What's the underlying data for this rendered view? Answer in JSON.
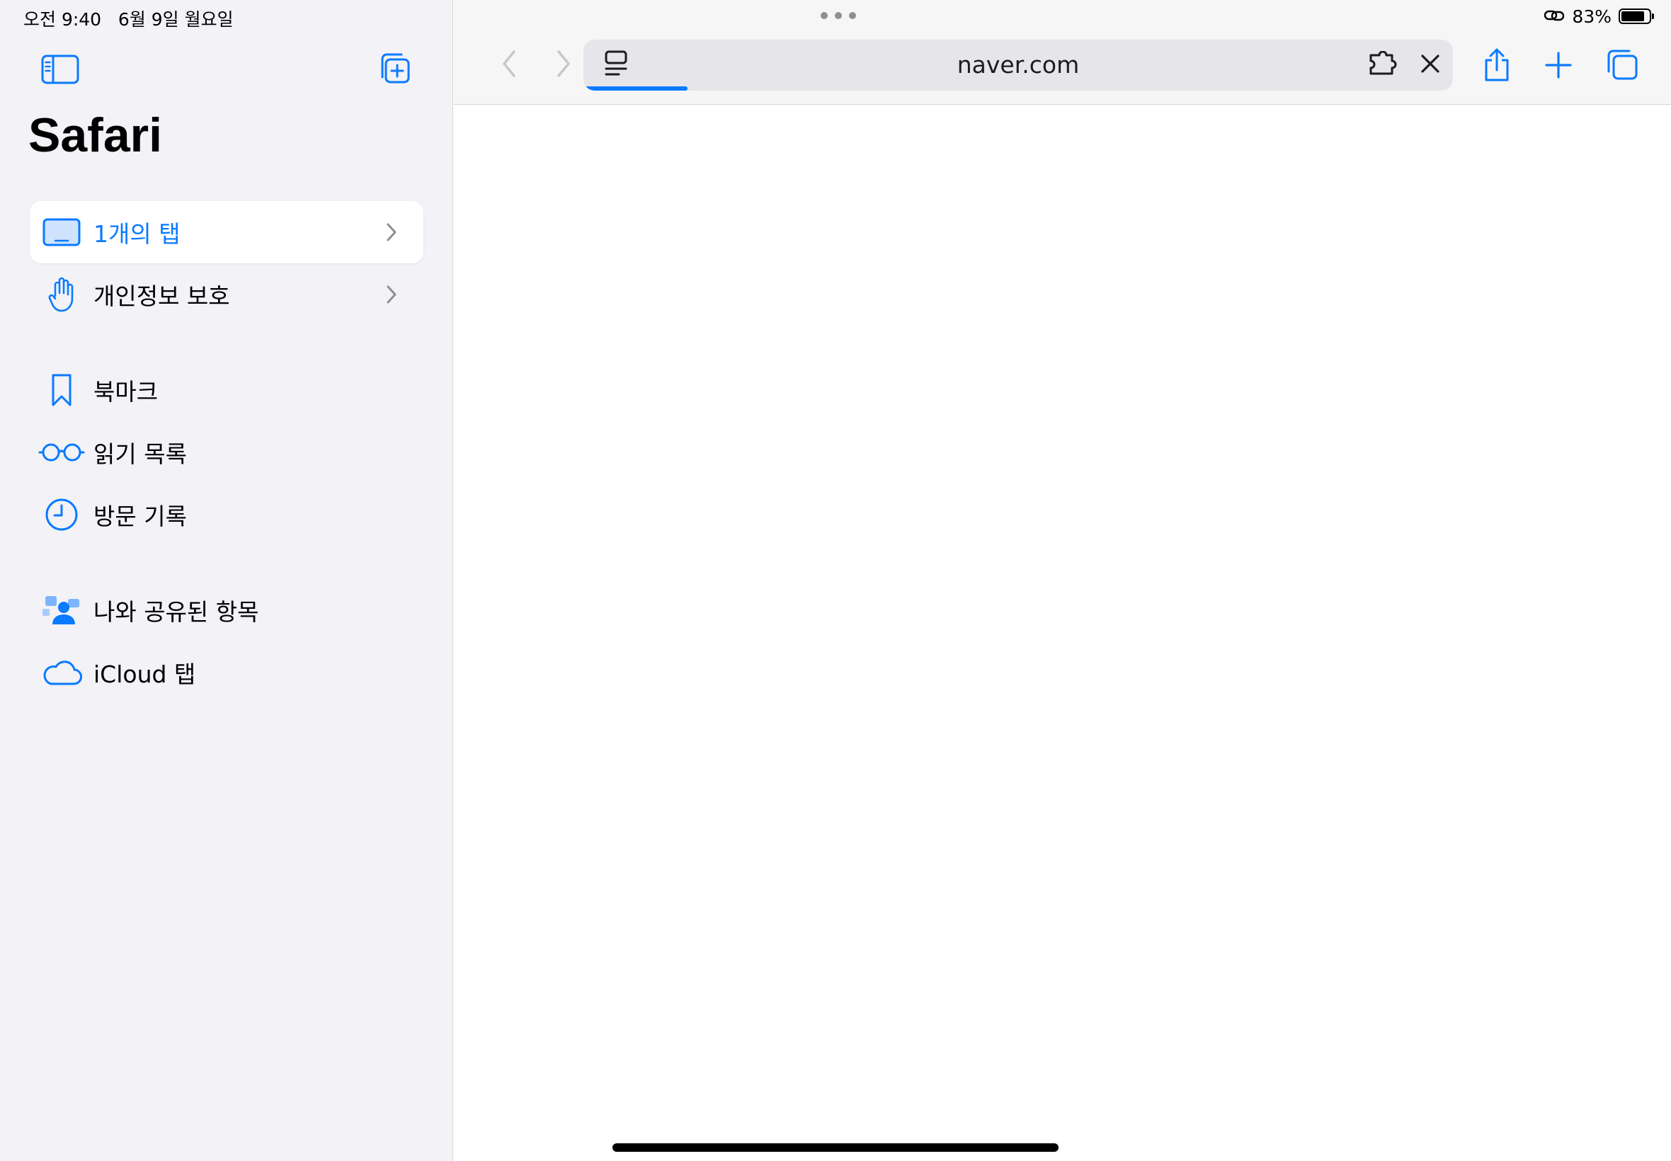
{
  "status_bar": {
    "time_date": "오전 9:40   6월 9일 월요일",
    "battery_percent": "83%",
    "battery_level": 0.83
  },
  "sidebar": {
    "title": "Safari",
    "groups": [
      {
        "items": [
          {
            "label": "1개의 탭",
            "icon": "tab-group-icon",
            "selected": true,
            "chevron": true
          },
          {
            "label": "개인정보 보호",
            "icon": "hand-raised-icon",
            "selected": false,
            "chevron": true
          }
        ]
      },
      {
        "items": [
          {
            "label": "북마크",
            "icon": "bookmark-icon"
          },
          {
            "label": "읽기 목록",
            "icon": "glasses-icon"
          },
          {
            "label": "방문 기록",
            "icon": "clock-icon"
          }
        ]
      },
      {
        "items": [
          {
            "label": "나와 공유된 항목",
            "icon": "shared-with-you-icon"
          },
          {
            "label": "iCloud 탭",
            "icon": "cloud-icon"
          }
        ]
      }
    ]
  },
  "toolbar": {
    "url": "naver.com",
    "load_progress": 0.12
  },
  "colors": {
    "accent": "#0a7aff",
    "sidebar_bg": "#f2f2f7",
    "address_bg": "#e5e5ea",
    "disabled": "#c7c7cc"
  }
}
